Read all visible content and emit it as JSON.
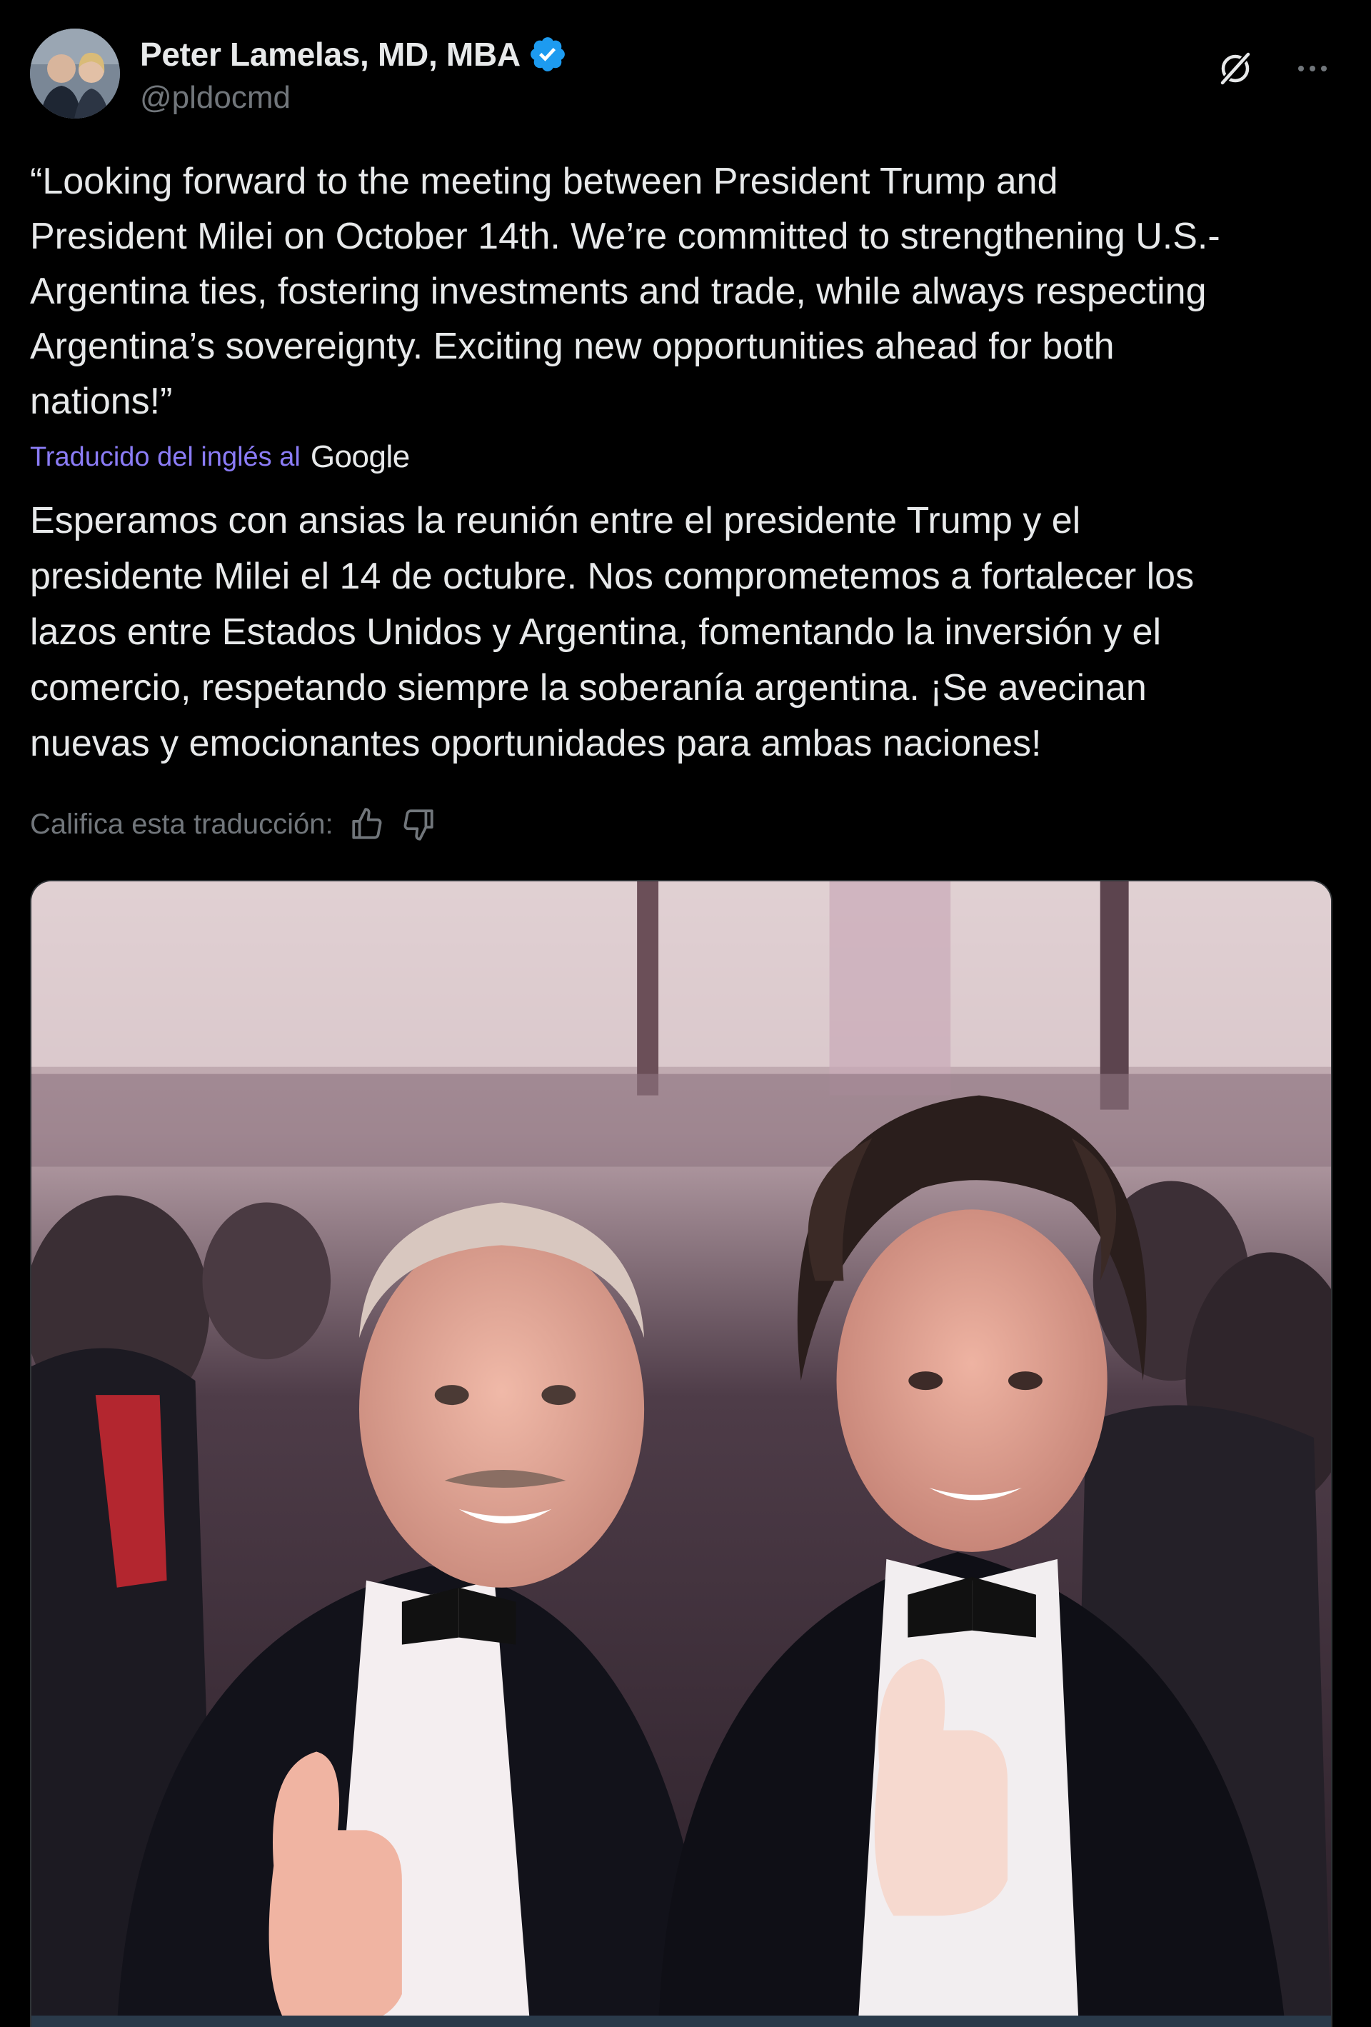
{
  "author": {
    "display_name": "Peter Lamelas, MD, MBA",
    "handle": "@pldocmd",
    "verified": true,
    "verified_color": "#1d9bf0"
  },
  "tweet": {
    "text": "“Looking forward to the meeting between President Trump and\nPresident Milei on October 14th. We’re committed to strengthening U.S.-\nArgentina ties, fostering investments and trade, while always respecting\nArgentina’s sovereignty. Exciting new opportunities ahead for both\nnations!”"
  },
  "translation": {
    "label": "Traducido del inglés al",
    "provider": "Google",
    "text": "Esperamos con ansias la reunión entre el presidente Trump y el\npresidente Milei el 14 de octubre. Nos comprometemos a fortalecer los\nlazos entre Estados Unidos y Argentina, fomentando la inversión y el\ncomercio, respetando siempre la soberanía argentina. ¡Se avecinan\nnuevas y emocionantes oportunidades para ambas naciones!",
    "rate_label": "Califica esta traducción:",
    "link_color": "#8b7cf6"
  },
  "icons": {
    "grok": "grok-icon",
    "more": "more-options-icon",
    "thumb_up": "thumbs-up-icon",
    "thumb_down": "thumbs-down-icon"
  },
  "colors": {
    "background": "#000000",
    "text_primary": "#e7e9ea",
    "text_secondary": "#71767b"
  }
}
